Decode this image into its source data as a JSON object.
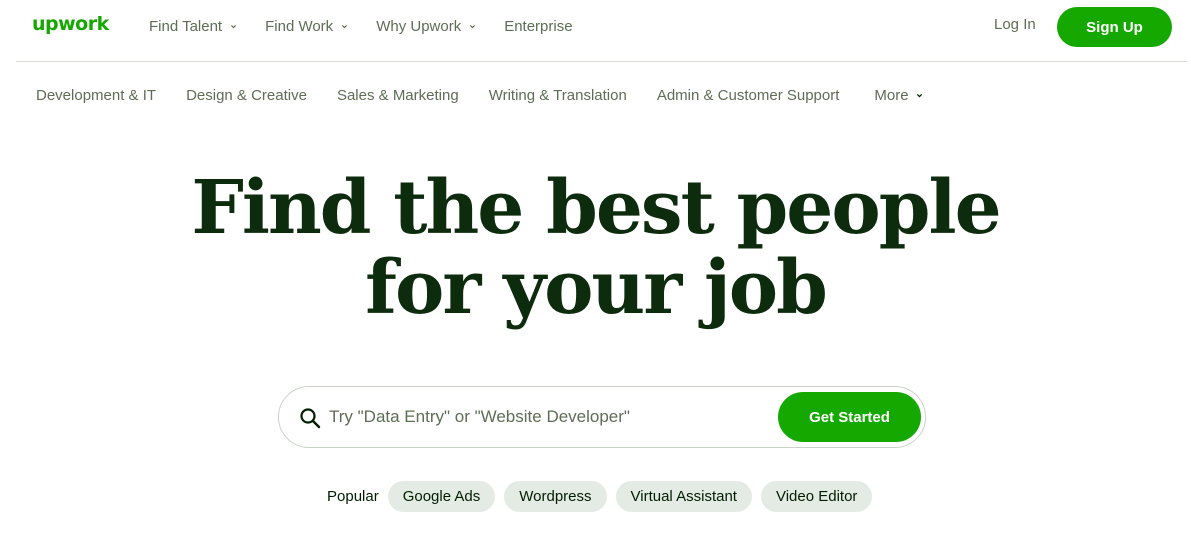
{
  "colors": {
    "brand": "#14a800",
    "text": "#001e00",
    "muted": "#5e6d55",
    "chip_bg": "#e4ebe4"
  },
  "header": {
    "logo_text": "upwork",
    "nav": [
      {
        "label": "Find Talent",
        "icon": "chevron-down-icon"
      },
      {
        "label": "Find Work",
        "icon": "chevron-down-icon"
      },
      {
        "label": "Why Upwork",
        "icon": "chevron-down-icon"
      },
      {
        "label": "Enterprise"
      }
    ],
    "login_label": "Log In",
    "signup_label": "Sign Up"
  },
  "categories": {
    "items": [
      "Development & IT",
      "Design & Creative",
      "Sales & Marketing",
      "Writing & Translation",
      "Admin & Customer Support"
    ],
    "more_label": "More"
  },
  "hero": {
    "line1": "Find the best people",
    "line2": "for your job"
  },
  "search": {
    "placeholder": "Try \"Data Entry\" or \"Website Developer\"",
    "value": "",
    "icon": "search-icon",
    "button_label": "Get Started"
  },
  "popular": {
    "label": "Popular",
    "chips": [
      "Google Ads",
      "Wordpress",
      "Virtual Assistant",
      "Video Editor"
    ]
  }
}
